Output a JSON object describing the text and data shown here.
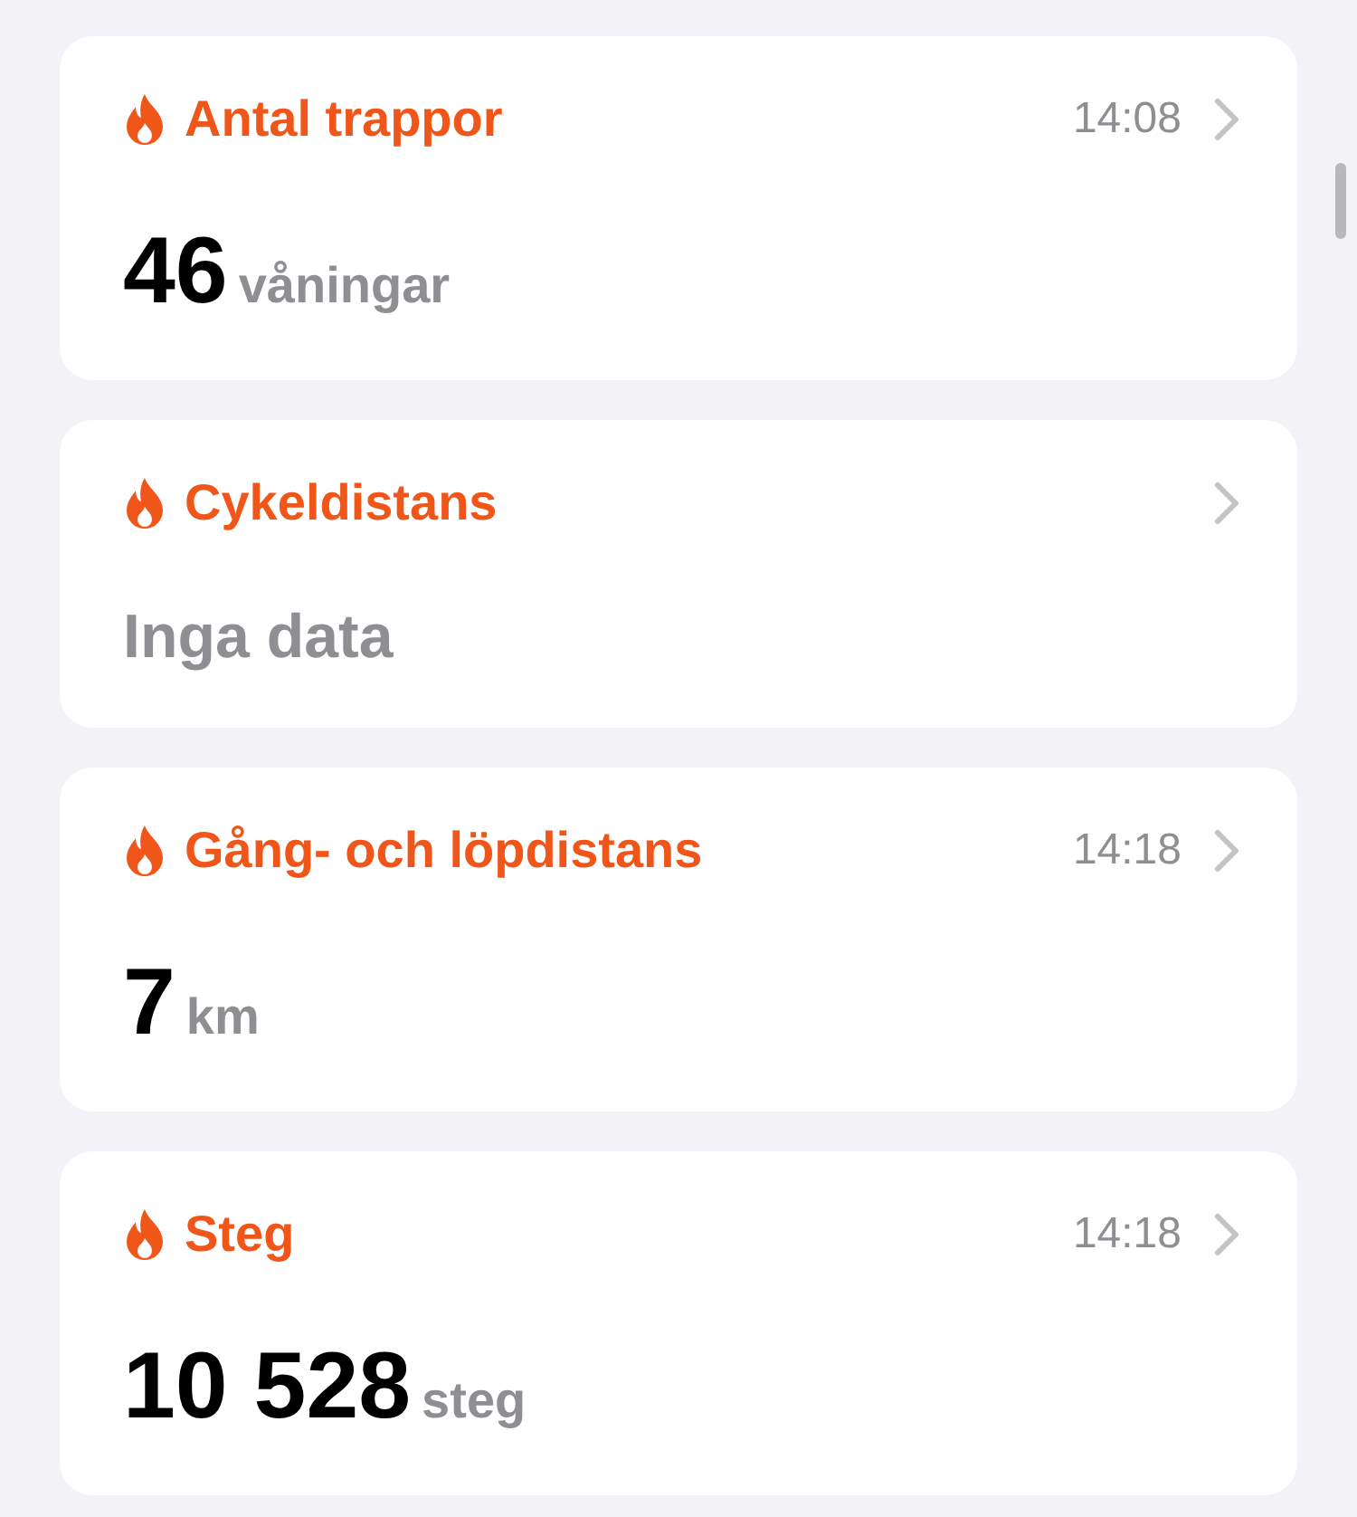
{
  "cards": [
    {
      "title": "Antal trappor",
      "time": "14:08",
      "kind": "value",
      "value": "46",
      "unit": "våningar"
    },
    {
      "title": "Cykeldistans",
      "kind": "empty",
      "value": "Inga data"
    },
    {
      "title": "Gång- och löpdistans",
      "time": "14:18",
      "kind": "value",
      "value": "7",
      "unit": "km"
    },
    {
      "title": "Steg",
      "time": "14:18",
      "kind": "value",
      "value": "10 528",
      "unit": "steg"
    }
  ]
}
